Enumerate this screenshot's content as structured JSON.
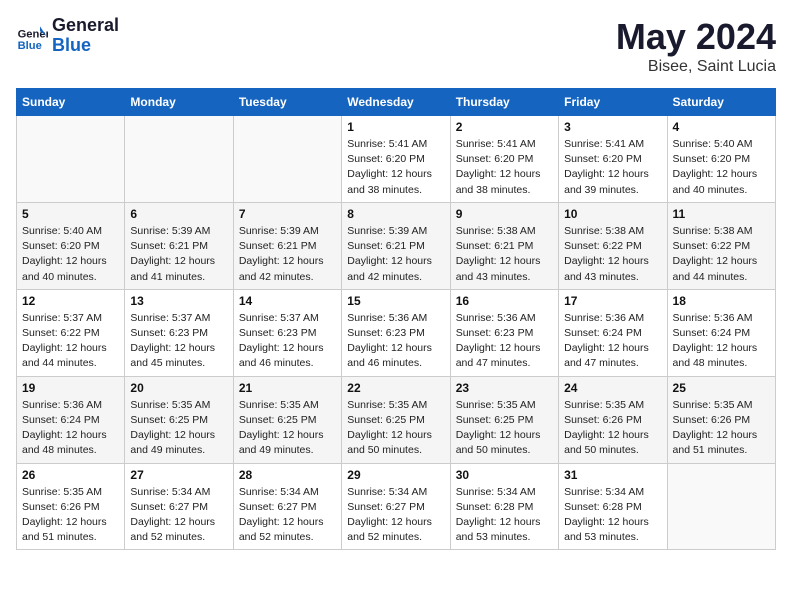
{
  "header": {
    "logo_general": "General",
    "logo_blue": "Blue",
    "month": "May 2024",
    "location": "Bisee, Saint Lucia"
  },
  "days_of_week": [
    "Sunday",
    "Monday",
    "Tuesday",
    "Wednesday",
    "Thursday",
    "Friday",
    "Saturday"
  ],
  "weeks": [
    [
      {
        "day": "",
        "sunrise": "",
        "sunset": "",
        "daylight": ""
      },
      {
        "day": "",
        "sunrise": "",
        "sunset": "",
        "daylight": ""
      },
      {
        "day": "",
        "sunrise": "",
        "sunset": "",
        "daylight": ""
      },
      {
        "day": "1",
        "sunrise": "5:41 AM",
        "sunset": "6:20 PM",
        "daylight": "12 hours and 38 minutes."
      },
      {
        "day": "2",
        "sunrise": "5:41 AM",
        "sunset": "6:20 PM",
        "daylight": "12 hours and 38 minutes."
      },
      {
        "day": "3",
        "sunrise": "5:41 AM",
        "sunset": "6:20 PM",
        "daylight": "12 hours and 39 minutes."
      },
      {
        "day": "4",
        "sunrise": "5:40 AM",
        "sunset": "6:20 PM",
        "daylight": "12 hours and 40 minutes."
      }
    ],
    [
      {
        "day": "5",
        "sunrise": "5:40 AM",
        "sunset": "6:20 PM",
        "daylight": "12 hours and 40 minutes."
      },
      {
        "day": "6",
        "sunrise": "5:39 AM",
        "sunset": "6:21 PM",
        "daylight": "12 hours and 41 minutes."
      },
      {
        "day": "7",
        "sunrise": "5:39 AM",
        "sunset": "6:21 PM",
        "daylight": "12 hours and 42 minutes."
      },
      {
        "day": "8",
        "sunrise": "5:39 AM",
        "sunset": "6:21 PM",
        "daylight": "12 hours and 42 minutes."
      },
      {
        "day": "9",
        "sunrise": "5:38 AM",
        "sunset": "6:21 PM",
        "daylight": "12 hours and 43 minutes."
      },
      {
        "day": "10",
        "sunrise": "5:38 AM",
        "sunset": "6:22 PM",
        "daylight": "12 hours and 43 minutes."
      },
      {
        "day": "11",
        "sunrise": "5:38 AM",
        "sunset": "6:22 PM",
        "daylight": "12 hours and 44 minutes."
      }
    ],
    [
      {
        "day": "12",
        "sunrise": "5:37 AM",
        "sunset": "6:22 PM",
        "daylight": "12 hours and 44 minutes."
      },
      {
        "day": "13",
        "sunrise": "5:37 AM",
        "sunset": "6:23 PM",
        "daylight": "12 hours and 45 minutes."
      },
      {
        "day": "14",
        "sunrise": "5:37 AM",
        "sunset": "6:23 PM",
        "daylight": "12 hours and 46 minutes."
      },
      {
        "day": "15",
        "sunrise": "5:36 AM",
        "sunset": "6:23 PM",
        "daylight": "12 hours and 46 minutes."
      },
      {
        "day": "16",
        "sunrise": "5:36 AM",
        "sunset": "6:23 PM",
        "daylight": "12 hours and 47 minutes."
      },
      {
        "day": "17",
        "sunrise": "5:36 AM",
        "sunset": "6:24 PM",
        "daylight": "12 hours and 47 minutes."
      },
      {
        "day": "18",
        "sunrise": "5:36 AM",
        "sunset": "6:24 PM",
        "daylight": "12 hours and 48 minutes."
      }
    ],
    [
      {
        "day": "19",
        "sunrise": "5:36 AM",
        "sunset": "6:24 PM",
        "daylight": "12 hours and 48 minutes."
      },
      {
        "day": "20",
        "sunrise": "5:35 AM",
        "sunset": "6:25 PM",
        "daylight": "12 hours and 49 minutes."
      },
      {
        "day": "21",
        "sunrise": "5:35 AM",
        "sunset": "6:25 PM",
        "daylight": "12 hours and 49 minutes."
      },
      {
        "day": "22",
        "sunrise": "5:35 AM",
        "sunset": "6:25 PM",
        "daylight": "12 hours and 50 minutes."
      },
      {
        "day": "23",
        "sunrise": "5:35 AM",
        "sunset": "6:25 PM",
        "daylight": "12 hours and 50 minutes."
      },
      {
        "day": "24",
        "sunrise": "5:35 AM",
        "sunset": "6:26 PM",
        "daylight": "12 hours and 50 minutes."
      },
      {
        "day": "25",
        "sunrise": "5:35 AM",
        "sunset": "6:26 PM",
        "daylight": "12 hours and 51 minutes."
      }
    ],
    [
      {
        "day": "26",
        "sunrise": "5:35 AM",
        "sunset": "6:26 PM",
        "daylight": "12 hours and 51 minutes."
      },
      {
        "day": "27",
        "sunrise": "5:34 AM",
        "sunset": "6:27 PM",
        "daylight": "12 hours and 52 minutes."
      },
      {
        "day": "28",
        "sunrise": "5:34 AM",
        "sunset": "6:27 PM",
        "daylight": "12 hours and 52 minutes."
      },
      {
        "day": "29",
        "sunrise": "5:34 AM",
        "sunset": "6:27 PM",
        "daylight": "12 hours and 52 minutes."
      },
      {
        "day": "30",
        "sunrise": "5:34 AM",
        "sunset": "6:28 PM",
        "daylight": "12 hours and 53 minutes."
      },
      {
        "day": "31",
        "sunrise": "5:34 AM",
        "sunset": "6:28 PM",
        "daylight": "12 hours and 53 minutes."
      },
      {
        "day": "",
        "sunrise": "",
        "sunset": "",
        "daylight": ""
      }
    ]
  ],
  "labels": {
    "sunrise": "Sunrise:",
    "sunset": "Sunset:",
    "daylight": "Daylight:"
  }
}
